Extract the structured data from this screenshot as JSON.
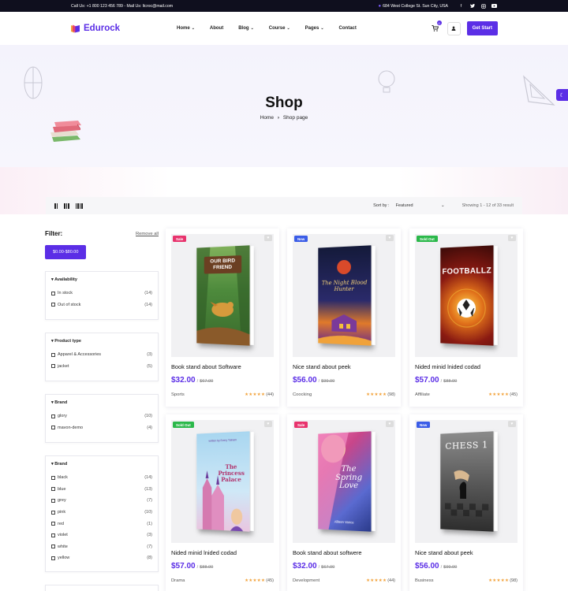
{
  "topbar": {
    "contact": "Call Us: +1 800 123 456 789 - Mail Us: ltcroc@mail.com",
    "address": "684 West College St. Sun City, USA"
  },
  "header": {
    "brand": "Edurock",
    "nav": [
      "Home",
      "About",
      "Blog",
      "Course",
      "Pages",
      "Contact"
    ],
    "cart_count": "0",
    "cta": "Get Start"
  },
  "hero": {
    "title": "Shop",
    "crumb_home": "Home",
    "crumb_current": "Shop page"
  },
  "toolbar": {
    "sort_label": "Sort by :",
    "sort_value": "Featured",
    "showing": "Showing 1 - 12 of 33 result"
  },
  "filter": {
    "title": "Filter:",
    "remove_all": "Remove all",
    "price_chip": "$0.00-$80.00",
    "groups": [
      {
        "title": "Availability",
        "items": [
          {
            "label": "In stock",
            "count": "(14)"
          },
          {
            "label": "Out of stock",
            "count": "(14)"
          }
        ]
      },
      {
        "title": "Product type",
        "items": [
          {
            "label": "Apparel & Accessories",
            "count": "(3)"
          },
          {
            "label": "jacket",
            "count": "(5)"
          }
        ]
      },
      {
        "title": "Brand",
        "items": [
          {
            "label": "glory",
            "count": "(10)"
          },
          {
            "label": "mavon-demo",
            "count": "(4)"
          }
        ]
      },
      {
        "title": "Brand",
        "items": [
          {
            "label": "black",
            "count": "(14)"
          },
          {
            "label": "blue",
            "count": "(13)"
          },
          {
            "label": "grey",
            "count": "(7)"
          },
          {
            "label": "pink",
            "count": "(10)"
          },
          {
            "label": "red",
            "count": "(1)"
          },
          {
            "label": "violet",
            "count": "(3)"
          },
          {
            "label": "white",
            "count": "(7)"
          },
          {
            "label": "yellow",
            "count": "(8)"
          }
        ]
      }
    ]
  },
  "products": [
    {
      "tag": "Sale",
      "tag_color": "#e8336d",
      "title": "Book stand about Software",
      "price": "$32.00",
      "old_price": "$67.00",
      "category": "Sports",
      "reviews": "(44)",
      "cover_title": "OUR BIRD FRIEND"
    },
    {
      "tag": "New",
      "tag_color": "#3b5de7",
      "title": "Nice stand about peek",
      "price": "$56.00",
      "old_price": "$99.00",
      "category": "Coocking",
      "reviews": "(98)",
      "cover_title": "The Night Blood Hunter"
    },
    {
      "tag": "Sold Out",
      "tag_color": "#2bb84a",
      "title": "Nided minid lnided codad",
      "price": "$57.00",
      "old_price": "$88.00",
      "category": "Affiliate",
      "reviews": "(45)",
      "cover_title": "FOOTBALLZ"
    },
    {
      "tag": "Sold Out",
      "tag_color": "#2bb84a",
      "title": "Nided minid lnided codad",
      "price": "$57.00",
      "old_price": "$88.00",
      "category": "Drama",
      "reviews": "(45)",
      "cover_title": "The Princess Palace",
      "cover_small": "written by Every Tolnam"
    },
    {
      "tag": "Sale",
      "tag_color": "#e8336d",
      "title": "Book stand about softwere",
      "price": "$32.00",
      "old_price": "$67.00",
      "category": "Development",
      "reviews": "(44)",
      "cover_title": "The Spring Love",
      "cover_small": "Allison Vance"
    },
    {
      "tag": "New",
      "tag_color": "#3b5de7",
      "title": "Nice stand about peek",
      "price": "$56.00",
      "old_price": "$99.00",
      "category": "Business",
      "reviews": "(98)",
      "cover_title": "CHESS 1"
    }
  ]
}
